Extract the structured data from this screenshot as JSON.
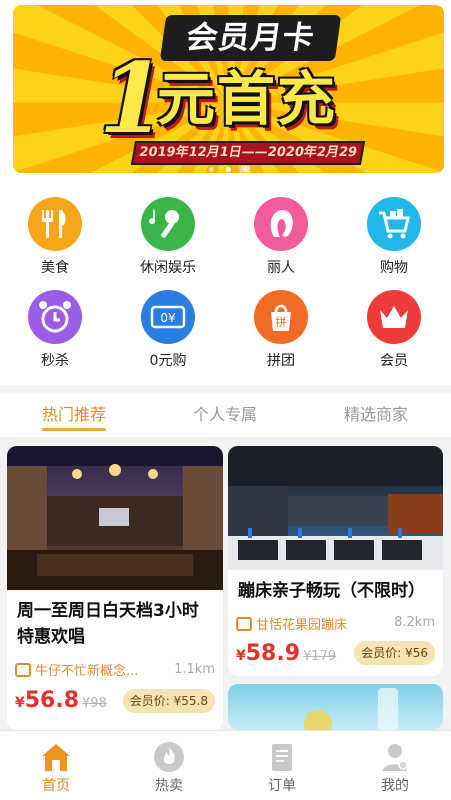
{
  "banner": {
    "headline": "会员月卡",
    "big_number": "1",
    "big_text": "元首充",
    "date_range": "2019年12月1日——2020年2月29日",
    "dot_count": 3,
    "active_dot": 1
  },
  "categories": [
    {
      "label": "美食",
      "icon": "food-icon",
      "color": "#f7a51d"
    },
    {
      "label": "休闲娱乐",
      "icon": "microphone-icon",
      "color": "#39b54a"
    },
    {
      "label": "丽人",
      "icon": "beauty-icon",
      "color": "#f25b9c"
    },
    {
      "label": "购物",
      "icon": "shopping-cart-icon",
      "color": "#22b6ea"
    },
    {
      "label": "秒杀",
      "icon": "alarm-clock-icon",
      "color": "#9b5de5"
    },
    {
      "label": "0元购",
      "icon": "coupon-icon",
      "color": "#2a7de1"
    },
    {
      "label": "拼团",
      "icon": "group-buy-icon",
      "color": "#f06b25"
    },
    {
      "label": "会员",
      "icon": "crown-icon",
      "color": "#ee3b3b"
    }
  ],
  "tabs": [
    {
      "label": "热门推荐",
      "active": true
    },
    {
      "label": "个人专属",
      "active": false
    },
    {
      "label": "精选商家",
      "active": false
    }
  ],
  "deals": [
    {
      "title": "周一至周日白天档3小时特惠欢唱",
      "shop": "牛仔不忙新概念...",
      "distance": "1.1km",
      "currency": "¥",
      "price": "56.8",
      "original_price": "¥98",
      "member_price": "会员价: ¥55.8"
    },
    {
      "title": "蹦床亲子畅玩（不限时）",
      "shop": "甘恬花果园蹦床",
      "distance": "8.2km",
      "currency": "¥",
      "price": "58.9",
      "original_price": "¥179",
      "member_price": "会员价: ¥56"
    }
  ],
  "nav": [
    {
      "label": "首页",
      "icon": "home-icon",
      "active": true
    },
    {
      "label": "热卖",
      "icon": "flame-icon",
      "active": false
    },
    {
      "label": "订单",
      "icon": "order-icon",
      "active": false
    },
    {
      "label": "我的",
      "icon": "profile-icon",
      "active": false
    }
  ],
  "colors": {
    "accent": "#e38a23",
    "price": "#e3322c",
    "member_badge_bg": "#f6e2b2"
  }
}
